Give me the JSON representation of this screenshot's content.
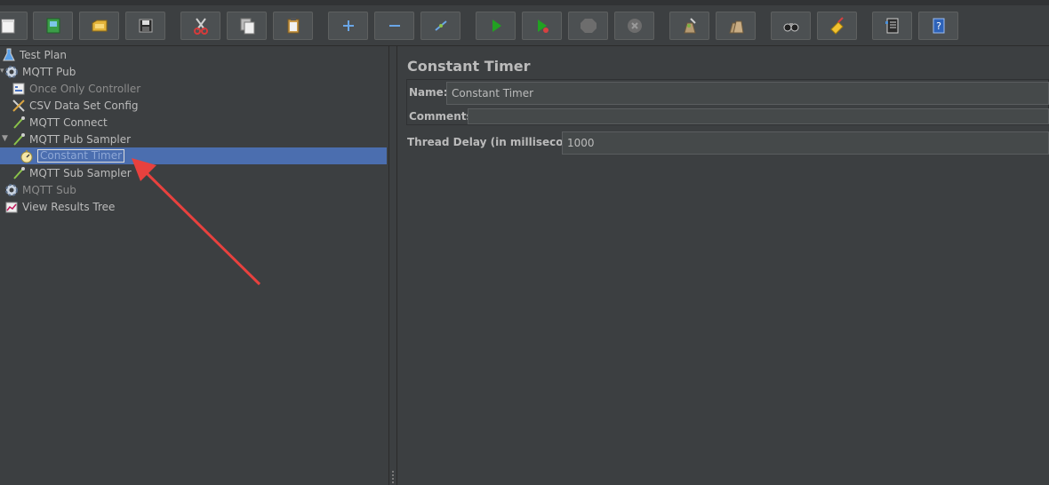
{
  "tree": {
    "items": [
      {
        "label": "Test Plan"
      },
      {
        "label": "MQTT Pub"
      },
      {
        "label": "Once Only Controller"
      },
      {
        "label": "CSV Data Set Config"
      },
      {
        "label": "MQTT Connect"
      },
      {
        "label": "MQTT Pub Sampler"
      },
      {
        "label": "Constant Timer"
      },
      {
        "label": "MQTT Sub Sampler"
      },
      {
        "label": "MQTT Sub"
      },
      {
        "label": "View Results Tree"
      }
    ]
  },
  "panel": {
    "title": "Constant Timer",
    "name_label": "Name:",
    "name_value": "Constant Timer",
    "comments_label": "Comments:",
    "comments_value": "",
    "delay_label": "Thread Delay (in milliseconds):",
    "delay_value": "1000"
  },
  "icons": {
    "toolbar": [
      "new-icon",
      "templates-icon",
      "open-icon",
      "save-icon",
      "cut-icon",
      "copy-icon",
      "paste-icon",
      "expand-icon",
      "collapse-icon",
      "toggle-icon",
      "start-icon",
      "start-no-pause-icon",
      "stop-icon",
      "shutdown-icon",
      "clear-icon",
      "clear-all-icon",
      "search-icon",
      "reset-search-icon",
      "function-helper-icon",
      "help-icon"
    ]
  },
  "colors": {
    "background": "#3c3f41",
    "selection": "#4b6eaf",
    "arrow": "#e8413e",
    "run_green": "#22a122"
  }
}
